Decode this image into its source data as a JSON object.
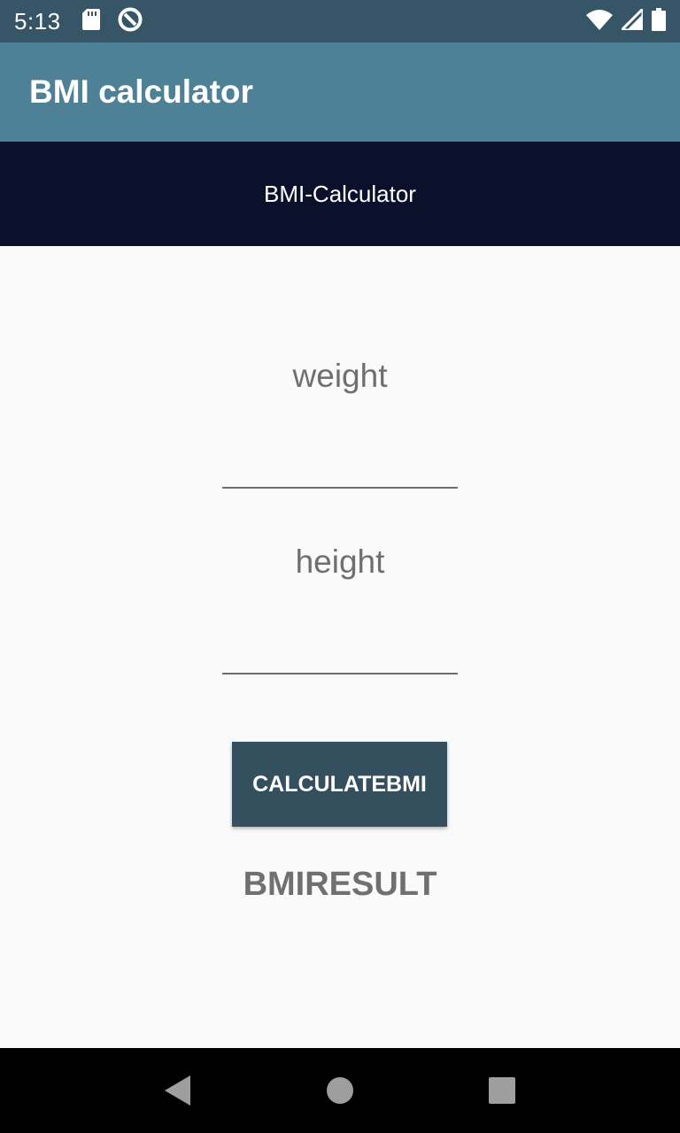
{
  "status_bar": {
    "time": "5:13",
    "left_icons": [
      "sd-card-icon",
      "do-not-disturb-icon"
    ],
    "right_icons": [
      "wifi-icon",
      "signal-icon",
      "battery-icon"
    ]
  },
  "app_bar": {
    "title": "BMI calculator"
  },
  "banner": {
    "text": "BMI-Calculator"
  },
  "form": {
    "weight_label": "weight",
    "weight_value": "",
    "height_label": "height",
    "height_value": "",
    "calculate_label": "CALCULATEBMI",
    "result_label": "BMIRESULT"
  },
  "nav_bar": {
    "buttons": [
      "back-icon",
      "home-icon",
      "recents-icon"
    ]
  },
  "colors": {
    "status_bar": "#365566",
    "app_bar": "#4f8196",
    "banner": "#0c112b",
    "button": "#34505f",
    "label_text": "#6f6f6f"
  }
}
